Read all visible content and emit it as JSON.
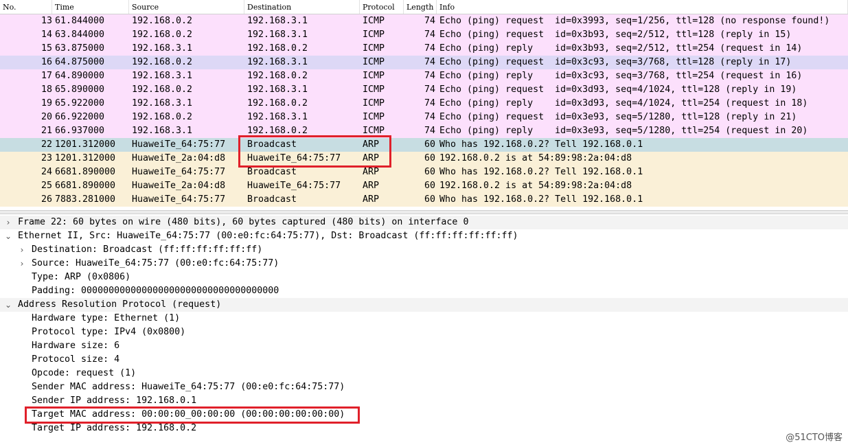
{
  "colors": {
    "icmp_row": "#fce0fc",
    "icmp_selected_row": "#ddd8f6",
    "arp_row": "#faf0d7",
    "selected_row": "#c7dde2",
    "details_bg": "#ffffff",
    "section_bg": "#f3f3f3",
    "annotation": "#e0202a"
  },
  "packet_list": {
    "columns": [
      "No.",
      "Time",
      "Source",
      "Destination",
      "Protocol",
      "Length",
      "Info"
    ],
    "rows": [
      {
        "no": "13",
        "time": "61.844000",
        "src": "192.168.0.2",
        "dst": "192.168.3.1",
        "proto": "ICMP",
        "len": "74",
        "info": "Echo (ping) request  id=0x3993, seq=1/256, ttl=128 (no response found!)",
        "kind": "icmp"
      },
      {
        "no": "14",
        "time": "63.844000",
        "src": "192.168.0.2",
        "dst": "192.168.3.1",
        "proto": "ICMP",
        "len": "74",
        "info": "Echo (ping) request  id=0x3b93, seq=2/512, ttl=128 (reply in 15)",
        "kind": "icmp"
      },
      {
        "no": "15",
        "time": "63.875000",
        "src": "192.168.3.1",
        "dst": "192.168.0.2",
        "proto": "ICMP",
        "len": "74",
        "info": "Echo (ping) reply    id=0x3b93, seq=2/512, ttl=254 (request in 14)",
        "kind": "icmp"
      },
      {
        "no": "16",
        "time": "64.875000",
        "src": "192.168.0.2",
        "dst": "192.168.3.1",
        "proto": "ICMP",
        "len": "74",
        "info": "Echo (ping) request  id=0x3c93, seq=3/768, ttl=128 (reply in 17)",
        "kind": "icmp-alt"
      },
      {
        "no": "17",
        "time": "64.890000",
        "src": "192.168.3.1",
        "dst": "192.168.0.2",
        "proto": "ICMP",
        "len": "74",
        "info": "Echo (ping) reply    id=0x3c93, seq=3/768, ttl=254 (request in 16)",
        "kind": "icmp"
      },
      {
        "no": "18",
        "time": "65.890000",
        "src": "192.168.0.2",
        "dst": "192.168.3.1",
        "proto": "ICMP",
        "len": "74",
        "info": "Echo (ping) request  id=0x3d93, seq=4/1024, ttl=128 (reply in 19)",
        "kind": "icmp"
      },
      {
        "no": "19",
        "time": "65.922000",
        "src": "192.168.3.1",
        "dst": "192.168.0.2",
        "proto": "ICMP",
        "len": "74",
        "info": "Echo (ping) reply    id=0x3d93, seq=4/1024, ttl=254 (request in 18)",
        "kind": "icmp"
      },
      {
        "no": "20",
        "time": "66.922000",
        "src": "192.168.0.2",
        "dst": "192.168.3.1",
        "proto": "ICMP",
        "len": "74",
        "info": "Echo (ping) request  id=0x3e93, seq=5/1280, ttl=128 (reply in 21)",
        "kind": "icmp"
      },
      {
        "no": "21",
        "time": "66.937000",
        "src": "192.168.3.1",
        "dst": "192.168.0.2",
        "proto": "ICMP",
        "len": "74",
        "info": "Echo (ping) reply    id=0x3e93, seq=5/1280, ttl=254 (request in 20)",
        "kind": "icmp"
      },
      {
        "no": "22",
        "time": "1201.312000",
        "src": "HuaweiTe_64:75:77",
        "dst": "Broadcast",
        "proto": "ARP",
        "len": "60",
        "info": "Who has 192.168.0.2? Tell 192.168.0.1",
        "kind": "selected"
      },
      {
        "no": "23",
        "time": "1201.312000",
        "src": "HuaweiTe_2a:04:d8",
        "dst": "HuaweiTe_64:75:77",
        "proto": "ARP",
        "len": "60",
        "info": "192.168.0.2 is at 54:89:98:2a:04:d8",
        "kind": "arp"
      },
      {
        "no": "24",
        "time": "6681.890000",
        "src": "HuaweiTe_64:75:77",
        "dst": "Broadcast",
        "proto": "ARP",
        "len": "60",
        "info": "Who has 192.168.0.2? Tell 192.168.0.1",
        "kind": "arp"
      },
      {
        "no": "25",
        "time": "6681.890000",
        "src": "HuaweiTe_2a:04:d8",
        "dst": "HuaweiTe_64:75:77",
        "proto": "ARP",
        "len": "60",
        "info": "192.168.0.2 is at 54:89:98:2a:04:d8",
        "kind": "arp"
      },
      {
        "no": "26",
        "time": "7883.281000",
        "src": "HuaweiTe_64:75:77",
        "dst": "Broadcast",
        "proto": "ARP",
        "len": "60",
        "info": "Who has 192.168.0.2? Tell 192.168.0.1",
        "kind": "arp"
      }
    ]
  },
  "details": [
    {
      "text": "Frame 22: 60 bytes on wire (480 bits), 60 bytes captured (480 bits) on interface 0",
      "arrow": "collapsed",
      "indent": 0
    },
    {
      "text": "Ethernet II, Src: HuaweiTe_64:75:77 (00:e0:fc:64:75:77), Dst: Broadcast (ff:ff:ff:ff:ff:ff)",
      "arrow": "expanded",
      "indent": 0
    },
    {
      "text": "Destination: Broadcast (ff:ff:ff:ff:ff:ff)",
      "arrow": "collapsed",
      "indent": 1
    },
    {
      "text": "Source: HuaweiTe_64:75:77 (00:e0:fc:64:75:77)",
      "arrow": "collapsed",
      "indent": 1
    },
    {
      "text": "Type: ARP (0x0806)",
      "arrow": "none",
      "indent": 1
    },
    {
      "text": "Padding: 000000000000000000000000000000000000",
      "arrow": "none",
      "indent": 1
    },
    {
      "text": "Address Resolution Protocol (request)",
      "arrow": "expanded",
      "indent": 0
    },
    {
      "text": "Hardware type: Ethernet (1)",
      "arrow": "none",
      "indent": 1
    },
    {
      "text": "Protocol type: IPv4 (0x0800)",
      "arrow": "none",
      "indent": 1
    },
    {
      "text": "Hardware size: 6",
      "arrow": "none",
      "indent": 1
    },
    {
      "text": "Protocol size: 4",
      "arrow": "none",
      "indent": 1
    },
    {
      "text": "Opcode: request (1)",
      "arrow": "none",
      "indent": 1
    },
    {
      "text": "Sender MAC address: HuaweiTe_64:75:77 (00:e0:fc:64:75:77)",
      "arrow": "none",
      "indent": 1
    },
    {
      "text": "Sender IP address: 192.168.0.1",
      "arrow": "none",
      "indent": 1
    },
    {
      "text": "Target MAC address: 00:00:00_00:00:00 (00:00:00:00:00:00)",
      "arrow": "none",
      "indent": 1
    },
    {
      "text": "Target IP address: 192.168.0.2",
      "arrow": "none",
      "indent": 1
    }
  ],
  "watermark": "@51CTO博客"
}
